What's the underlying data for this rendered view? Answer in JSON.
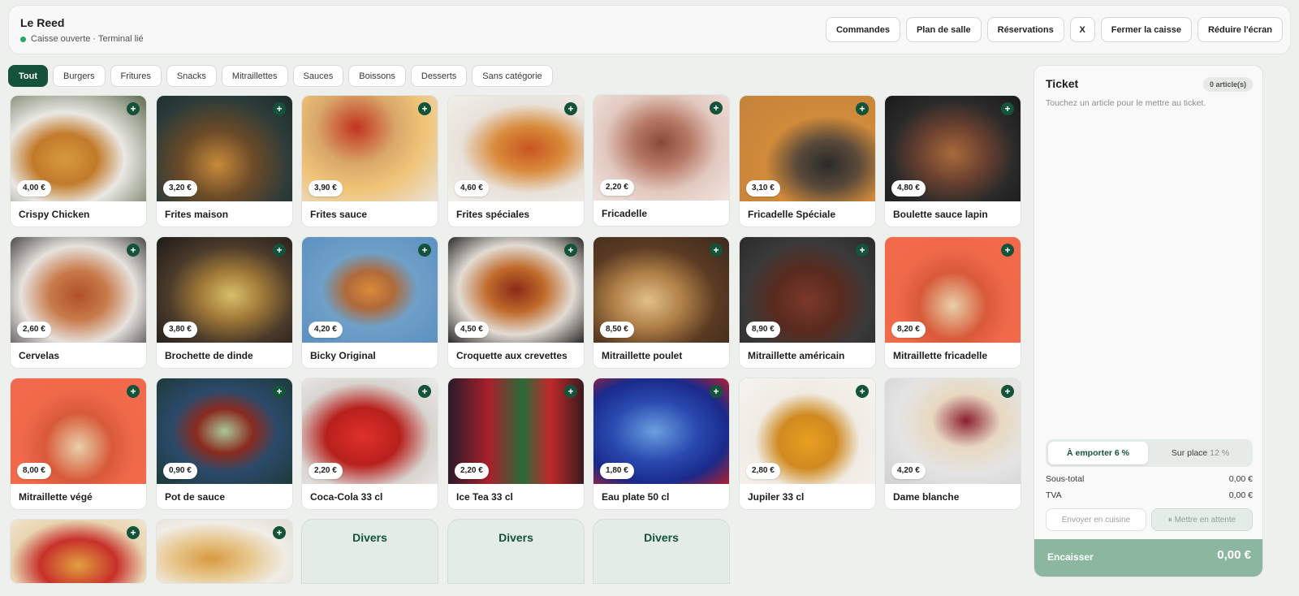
{
  "header": {
    "store_name": "Le Reed",
    "status": "Caisse ouverte · Terminal lié",
    "buttons": [
      "Commandes",
      "Plan de salle",
      "Réservations",
      "X",
      "Fermer la caisse",
      "Réduire l'écran"
    ]
  },
  "categories": [
    "Tout",
    "Burgers",
    "Fritures",
    "Snacks",
    "Mitraillettes",
    "Sauces",
    "Boissons",
    "Desserts",
    "Sans catégorie"
  ],
  "active_category": "Tout",
  "products": [
    {
      "name": "Crispy Chicken",
      "price": "4,00 €"
    },
    {
      "name": "Frites maison",
      "price": "3,20 €"
    },
    {
      "name": "Frites sauce",
      "price": "3,90 €"
    },
    {
      "name": "Frites spéciales",
      "price": "4,60 €"
    },
    {
      "name": "Fricadelle",
      "price": "2,20 €"
    },
    {
      "name": "Fricadelle Spéciale",
      "price": "3,10 €"
    },
    {
      "name": "Boulette sauce lapin",
      "price": "4,80 €"
    },
    {
      "name": "Cervelas",
      "price": "2,60 €"
    },
    {
      "name": "Brochette de dinde",
      "price": "3,80 €"
    },
    {
      "name": "Bicky Original",
      "price": "4,20 €"
    },
    {
      "name": "Croquette aux crevettes",
      "price": "4,50 €"
    },
    {
      "name": "Mitraillette poulet",
      "price": "8,50 €"
    },
    {
      "name": "Mitraillette américain",
      "price": "8,90 €"
    },
    {
      "name": "Mitraillette fricadelle",
      "price": "8,20 €"
    },
    {
      "name": "Mitraillette végé",
      "price": "8,00 €"
    },
    {
      "name": "Pot de sauce",
      "price": "0,90 €"
    },
    {
      "name": "Coca-Cola 33 cl",
      "price": "2,20 €"
    },
    {
      "name": "Ice Tea 33 cl",
      "price": "2,20 €"
    },
    {
      "name": "Eau plate 50 cl",
      "price": "1,80 €"
    },
    {
      "name": "Jupiler 33 cl",
      "price": "2,80 €"
    },
    {
      "name": "Dame blanche",
      "price": "4,20 €"
    }
  ],
  "divers_label": "Divers",
  "ticket": {
    "title": "Ticket",
    "count": "0 article(s)",
    "hint": "Touchez un article pour le mettre au ticket.",
    "mode_takeaway": "À emporter 6 %",
    "mode_dinein": "Sur place",
    "mode_dinein_pct": "12 %",
    "subtotal_label": "Sous-total",
    "subtotal_value": "0,00 €",
    "tva_label": "TVA",
    "tva_value": "0,00 €",
    "send_kitchen": "Envoyer en cuisine",
    "hold": "Mettre en attente",
    "pay_label": "Encaisser",
    "pay_total": "0,00 €"
  },
  "colors": {
    "accent": "#14533a",
    "pay_button": "#8bb6a0"
  }
}
